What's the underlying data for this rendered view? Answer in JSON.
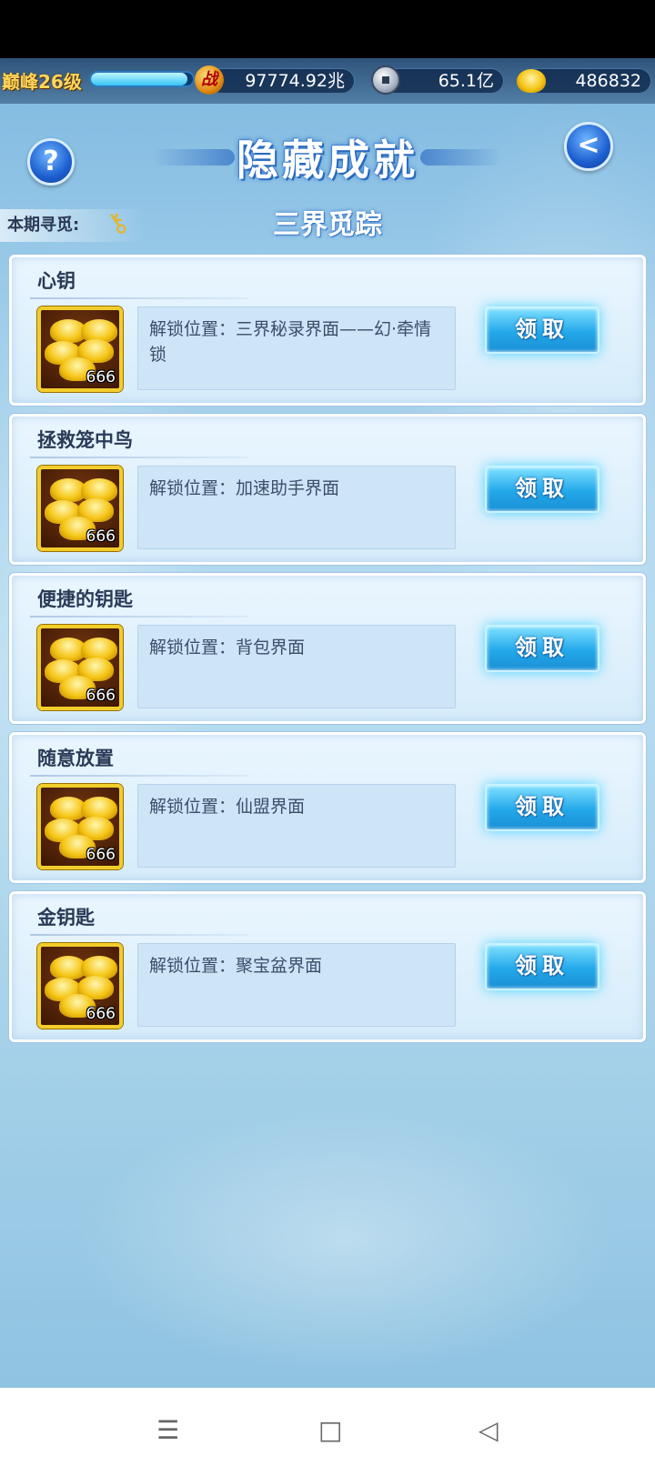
{
  "resources": {
    "level": "巅峰26级",
    "power_badge": "战",
    "power": "97774.92兆",
    "silver": "65.1亿",
    "gold": "486832"
  },
  "header": {
    "title": "隐藏成就",
    "help_label": "?",
    "back_label": "<",
    "period_label": "本期寻觅:",
    "subtitle": "三界觅踪"
  },
  "achievements": [
    {
      "name": "心钥",
      "reward_count": "666",
      "description": "解锁位置：三界秘录界面——幻·牵情锁",
      "button": "领取"
    },
    {
      "name": "拯救笼中鸟",
      "reward_count": "666",
      "description": "解锁位置：加速助手界面",
      "button": "领取"
    },
    {
      "name": "便捷的钥匙",
      "reward_count": "666",
      "description": "解锁位置：背包界面",
      "button": "领取"
    },
    {
      "name": "随意放置",
      "reward_count": "666",
      "description": "解锁位置：仙盟界面",
      "button": "领取"
    },
    {
      "name": "金钥匙",
      "reward_count": "666",
      "description": "解锁位置：聚宝盆界面",
      "button": "领取"
    }
  ],
  "nav": {
    "menu_icon": "☰",
    "home_icon": "□",
    "back_icon": "◁"
  },
  "colors": {
    "accent": "#23a8ea",
    "title_text": "#2a3a56",
    "gold": "#f2cd2b"
  },
  "level_progress": 0.95
}
